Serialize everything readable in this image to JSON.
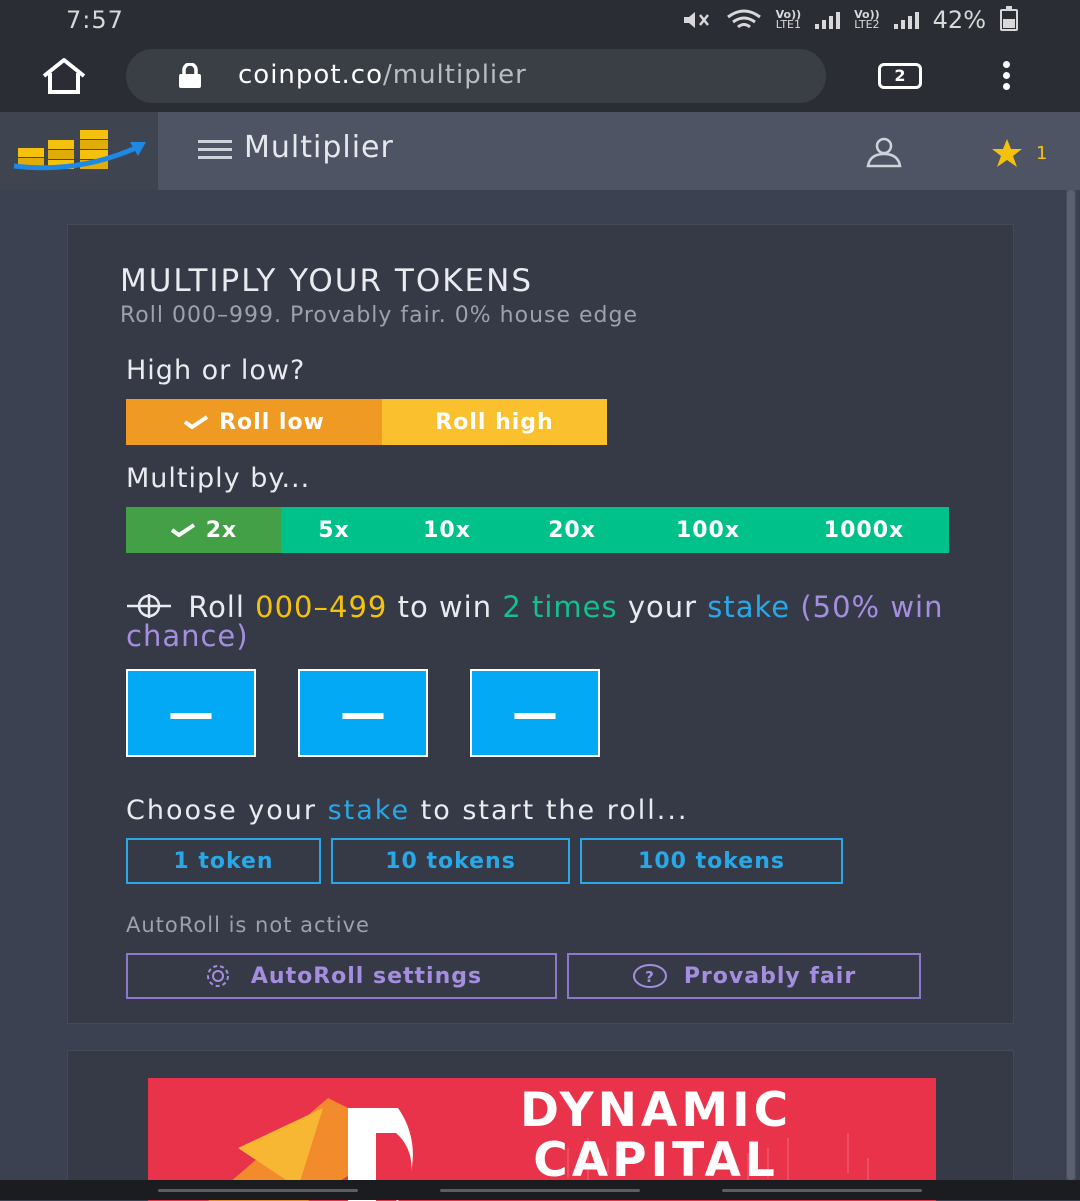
{
  "status_bar": {
    "time": "7:57",
    "sim1_top": "Vo))",
    "sim1_bottom": "LTE1",
    "sim2_top": "Vo))",
    "sim2_bottom": "LTE2",
    "battery": "42%"
  },
  "browser": {
    "domain": "coinpot.co",
    "path": "/multiplier",
    "tab_count": "2"
  },
  "header": {
    "title": "Multiplier",
    "star_count": "1"
  },
  "game": {
    "heading": "MULTIPLY YOUR TOKENS",
    "subheading": "Roll 000–999. Provably fair. 0% house edge",
    "high_low_label": "High or low?",
    "roll_low": "Roll low",
    "roll_high": "Roll high",
    "multiply_label": "Multiply by...",
    "multipliers": [
      "2x",
      "5x",
      "10x",
      "20x",
      "100x",
      "1000x"
    ],
    "selected_multiplier": "2x",
    "roll_prefix": "Roll",
    "roll_range": "000–499",
    "to_win": "to win",
    "times": "2 times",
    "your": "your",
    "stake_word": "stake",
    "win_chance": "(50% win chance)",
    "digits": [
      "—",
      "—",
      "—"
    ],
    "choose_prefix": "Choose your",
    "choose_stake": "stake",
    "choose_suffix": "to start the roll...",
    "stakes": [
      "1 token",
      "10 tokens",
      "100 tokens"
    ],
    "autoroll_status": "AutoRoll is not active",
    "autoroll_settings": "AutoRoll settings",
    "provably_fair": "Provably fair"
  },
  "ad": {
    "line1": "DYNAMIC",
    "line2": "CAPITAL"
  },
  "colors": {
    "roll_low": "#ef9a22",
    "roll_high": "#fbc02d",
    "mult_selected": "#43a047",
    "mult_default": "#00c18a",
    "digit_box": "#03a9f4",
    "purple": "#a58ee0"
  }
}
